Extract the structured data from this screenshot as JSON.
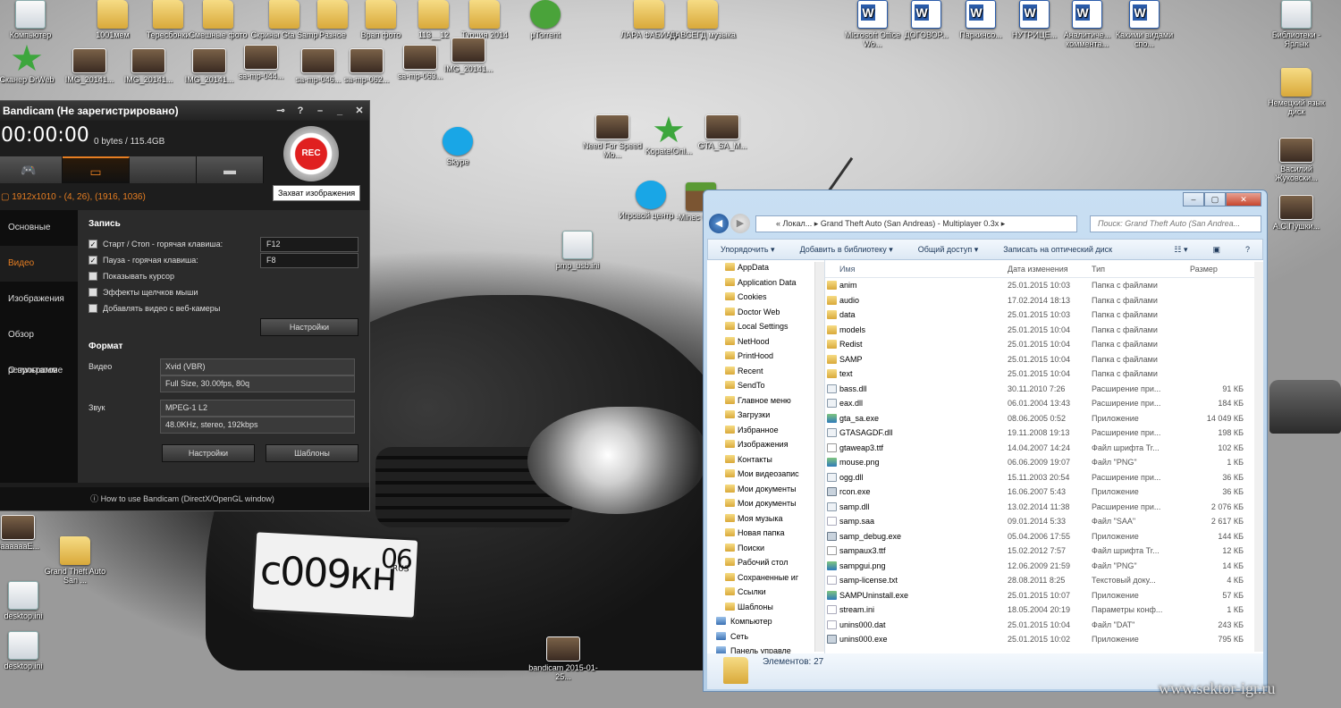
{
  "desktop": {
    "icons": [
      {
        "id": "computer",
        "label": "Компьютер",
        "kind": "file"
      },
      {
        "id": "1001",
        "label": "1001мем",
        "kind": "folder"
      },
      {
        "id": "tereshonki",
        "label": "Тересбонки",
        "kind": "folder"
      },
      {
        "id": "smeshnye",
        "label": "Смешные фото",
        "kind": "folder"
      },
      {
        "id": "skriny",
        "label": "Скрины Gta Samp",
        "kind": "folder"
      },
      {
        "id": "raznoe",
        "label": "Разное",
        "kind": "folder"
      },
      {
        "id": "vrap",
        "label": "Врап фото",
        "kind": "folder"
      },
      {
        "id": "l13",
        "label": "113__12",
        "kind": "folder"
      },
      {
        "id": "turkey",
        "label": "Турция 2014",
        "kind": "folder"
      },
      {
        "id": "utorrent",
        "label": "µTorrent",
        "kind": "utor"
      },
      {
        "id": "lara",
        "label": "ЛАРА ФАБИАН",
        "kind": "folder"
      },
      {
        "id": "davsegda",
        "label": "ДАВСЕГД музыка",
        "kind": "folder"
      },
      {
        "id": "msword",
        "label": "Microsoft Office Wo...",
        "kind": "word"
      },
      {
        "id": "dogovor",
        "label": "ДОГОВОР...",
        "kind": "word"
      },
      {
        "id": "parkinso",
        "label": "Паркинсо...",
        "kind": "word"
      },
      {
        "id": "nutrice",
        "label": "НУТРИЦЕ...",
        "kind": "word"
      },
      {
        "id": "analit",
        "label": "Аналитиче... коммента...",
        "kind": "word"
      },
      {
        "id": "kakimi",
        "label": "Какими видами спо...",
        "kind": "word"
      },
      {
        "id": "libs",
        "label": "Библиотеки - Ярлык",
        "kind": "file"
      },
      {
        "id": "scanner",
        "label": "Сканер DrWeb",
        "kind": "green"
      },
      {
        "id": "img1",
        "label": "IMG_20141...",
        "kind": "photo"
      },
      {
        "id": "img2",
        "label": "IMG_20141...",
        "kind": "photo"
      },
      {
        "id": "img3",
        "label": "IMG_20141...",
        "kind": "photo"
      },
      {
        "id": "sa1",
        "label": "sa-mp-044...",
        "kind": "photo"
      },
      {
        "id": "sa2",
        "label": "sa-mp-046...",
        "kind": "photo"
      },
      {
        "id": "sa3",
        "label": "sa-mp-062...",
        "kind": "photo"
      },
      {
        "id": "sa4",
        "label": "sa-mp-063...",
        "kind": "photo"
      },
      {
        "id": "img4",
        "label": "IMG_20141...",
        "kind": "photo"
      },
      {
        "id": "german",
        "label": "Немецкий язык диск",
        "kind": "folder"
      },
      {
        "id": "vasiliy",
        "label": "Василий Жуковски...",
        "kind": "photo"
      },
      {
        "id": "pushkin",
        "label": "А.С.Пушки...",
        "kind": "photo"
      },
      {
        "id": "skype",
        "label": "Skype",
        "kind": "skype"
      },
      {
        "id": "nfs",
        "label": "Need For Speed Mo...",
        "kind": "photo"
      },
      {
        "id": "karate",
        "label": "Kopate!Onl...",
        "kind": "green"
      },
      {
        "id": "gtasa",
        "label": "GTA_SA_M...",
        "kind": "photo"
      },
      {
        "id": "igrovoy",
        "label": "Игровой центр ...",
        "kind": "skype"
      },
      {
        "id": "minecraft",
        "label": "Minec minec",
        "kind": "cube"
      },
      {
        "id": "pmp",
        "label": "pmp_usb.ini",
        "kind": "file"
      },
      {
        "id": "saaaa",
        "label": "saaaaaaE...",
        "kind": "photo"
      },
      {
        "id": "gtsa",
        "label": "Grand Theft Auto San ...",
        "kind": "folder"
      },
      {
        "id": "desk1",
        "label": "desktop.ini",
        "kind": "file"
      },
      {
        "id": "desk2",
        "label": "desktop.ini",
        "kind": "file"
      },
      {
        "id": "bandifile",
        "label": "bandicam 2015-01-25...",
        "kind": "photo"
      }
    ],
    "plate": {
      "number": "с009кн",
      "region": "06",
      "country": "RUS"
    },
    "watermark": "www.sektor-igr.ru"
  },
  "bandicam": {
    "title": "Bandicam (Не зарегистрировано)",
    "timer": "00:00:00",
    "size": "0 bytes / 115.4GB",
    "rec_label": "REC",
    "resolution": "1912x1010 - (4, 26), (1916, 1036)",
    "tooltip": "Захват изображения",
    "sidebar": [
      "Основные",
      "Видео",
      "Изображения",
      "Обзор результатов",
      "О программе"
    ],
    "record_header": "Запись",
    "options": [
      {
        "label": "Старт / Стоп - горячая клавиша:",
        "checked": true,
        "key": "F12"
      },
      {
        "label": "Пауза - горячая клавиша:",
        "checked": true,
        "key": "F8"
      },
      {
        "label": "Показывать курсор",
        "checked": false,
        "key": ""
      },
      {
        "label": "Эффекты щелчков мыши",
        "checked": false,
        "key": ""
      },
      {
        "label": "Добавлять видео с веб-камеры",
        "checked": false,
        "key": ""
      }
    ],
    "settings_btn": "Настройки",
    "format_header": "Формат",
    "video_label": "Видео",
    "video_codec": "Xvid (VBR)",
    "video_detail": "Full Size, 30.00fps, 80q",
    "audio_label": "Звук",
    "audio_codec": "MPEG-1 L2",
    "audio_detail": "48.0KHz, stereo, 192kbps",
    "settings2_btn": "Настройки",
    "templates_btn": "Шаблоны",
    "footer": "How to use Bandicam (DirectX/OpenGL window)"
  },
  "explorer": {
    "address": "« Локал... ▸ Grand Theft Auto (San Andreas) - Multiplayer 0.3x ▸",
    "search_placeholder": "Поиск: Grand Theft Auto (San Andrea...",
    "toolbar": [
      "Упорядочить ▾",
      "Добавить в библиотеку ▾",
      "Общий доступ ▾",
      "Записать на оптический диск"
    ],
    "tree": [
      "AppData",
      "Application Data",
      "Cookies",
      "Doctor Web",
      "Local Settings",
      "NetHood",
      "PrintHood",
      "Recent",
      "SendTo",
      "Главное меню",
      "Загрузки",
      "Избранное",
      "Изображения",
      "Контакты",
      "Мои видеозапис",
      "Мои документы",
      "Мои документы",
      "Моя музыка",
      "Новая папка",
      "Поиски",
      "Рабочий стол",
      "Сохраненные иг",
      "Ссылки",
      "Шаблоны"
    ],
    "tree_sys": [
      "Компьютер",
      "Сеть",
      "Панель управле"
    ],
    "columns": {
      "name": "Имя",
      "date": "Дата изменения",
      "type": "Тип",
      "size": "Размер"
    },
    "files": [
      {
        "name": "anim",
        "date": "25.01.2015 10:03",
        "type": "Папка с файлами",
        "size": "",
        "icon": "folder"
      },
      {
        "name": "audio",
        "date": "17.02.2014 18:13",
        "type": "Папка с файлами",
        "size": "",
        "icon": "folder"
      },
      {
        "name": "data",
        "date": "25.01.2015 10:03",
        "type": "Папка с файлами",
        "size": "",
        "icon": "folder"
      },
      {
        "name": "models",
        "date": "25.01.2015 10:04",
        "type": "Папка с файлами",
        "size": "",
        "icon": "folder"
      },
      {
        "name": "Redist",
        "date": "25.01.2015 10:04",
        "type": "Папка с файлами",
        "size": "",
        "icon": "folder"
      },
      {
        "name": "SAMP",
        "date": "25.01.2015 10:04",
        "type": "Папка с файлами",
        "size": "",
        "icon": "folder"
      },
      {
        "name": "text",
        "date": "25.01.2015 10:04",
        "type": "Папка с файлами",
        "size": "",
        "icon": "folder"
      },
      {
        "name": "bass.dll",
        "date": "30.11.2010 7:26",
        "type": "Расширение при...",
        "size": "91 КБ",
        "icon": "dll"
      },
      {
        "name": "eax.dll",
        "date": "06.01.2004 13:43",
        "type": "Расширение при...",
        "size": "184 КБ",
        "icon": "dll"
      },
      {
        "name": "gta_sa.exe",
        "date": "08.06.2005 0:52",
        "type": "Приложение",
        "size": "14 049 КБ",
        "icon": "img"
      },
      {
        "name": "GTASAGDF.dll",
        "date": "19.11.2008 19:13",
        "type": "Расширение при...",
        "size": "198 КБ",
        "icon": "dll"
      },
      {
        "name": "gtaweap3.ttf",
        "date": "14.04.2007 14:24",
        "type": "Файл шрифта Tr...",
        "size": "102 КБ",
        "icon": "font"
      },
      {
        "name": "mouse.png",
        "date": "06.06.2009 19:07",
        "type": "Файл \"PNG\"",
        "size": "1 КБ",
        "icon": "img"
      },
      {
        "name": "ogg.dll",
        "date": "15.11.2003 20:54",
        "type": "Расширение при...",
        "size": "36 КБ",
        "icon": "dll"
      },
      {
        "name": "rcon.exe",
        "date": "16.06.2007 5:43",
        "type": "Приложение",
        "size": "36 КБ",
        "icon": "exe"
      },
      {
        "name": "samp.dll",
        "date": "13.02.2014 11:38",
        "type": "Расширение при...",
        "size": "2 076 КБ",
        "icon": "dll"
      },
      {
        "name": "samp.saa",
        "date": "09.01.2014 5:33",
        "type": "Файл \"SAA\"",
        "size": "2 617 КБ",
        "icon": "doc"
      },
      {
        "name": "samp_debug.exe",
        "date": "05.04.2006 17:55",
        "type": "Приложение",
        "size": "144 КБ",
        "icon": "exe"
      },
      {
        "name": "sampaux3.ttf",
        "date": "15.02.2012 7:57",
        "type": "Файл шрифта Tr...",
        "size": "12 КБ",
        "icon": "font"
      },
      {
        "name": "sampgui.png",
        "date": "12.06.2009 21:59",
        "type": "Файл \"PNG\"",
        "size": "14 КБ",
        "icon": "img"
      },
      {
        "name": "samp-license.txt",
        "date": "28.08.2011 8:25",
        "type": "Текстовый доку...",
        "size": "4 КБ",
        "icon": "doc"
      },
      {
        "name": "SAMPUninstall.exe",
        "date": "25.01.2015 10:07",
        "type": "Приложение",
        "size": "57 КБ",
        "icon": "img"
      },
      {
        "name": "stream.ini",
        "date": "18.05.2004 20:19",
        "type": "Параметры конф...",
        "size": "1 КБ",
        "icon": "doc"
      },
      {
        "name": "unins000.dat",
        "date": "25.01.2015 10:04",
        "type": "Файл \"DAT\"",
        "size": "243 КБ",
        "icon": "doc"
      },
      {
        "name": "unins000.exe",
        "date": "25.01.2015 10:02",
        "type": "Приложение",
        "size": "795 КБ",
        "icon": "exe"
      }
    ],
    "status": "Элементов: 27"
  }
}
